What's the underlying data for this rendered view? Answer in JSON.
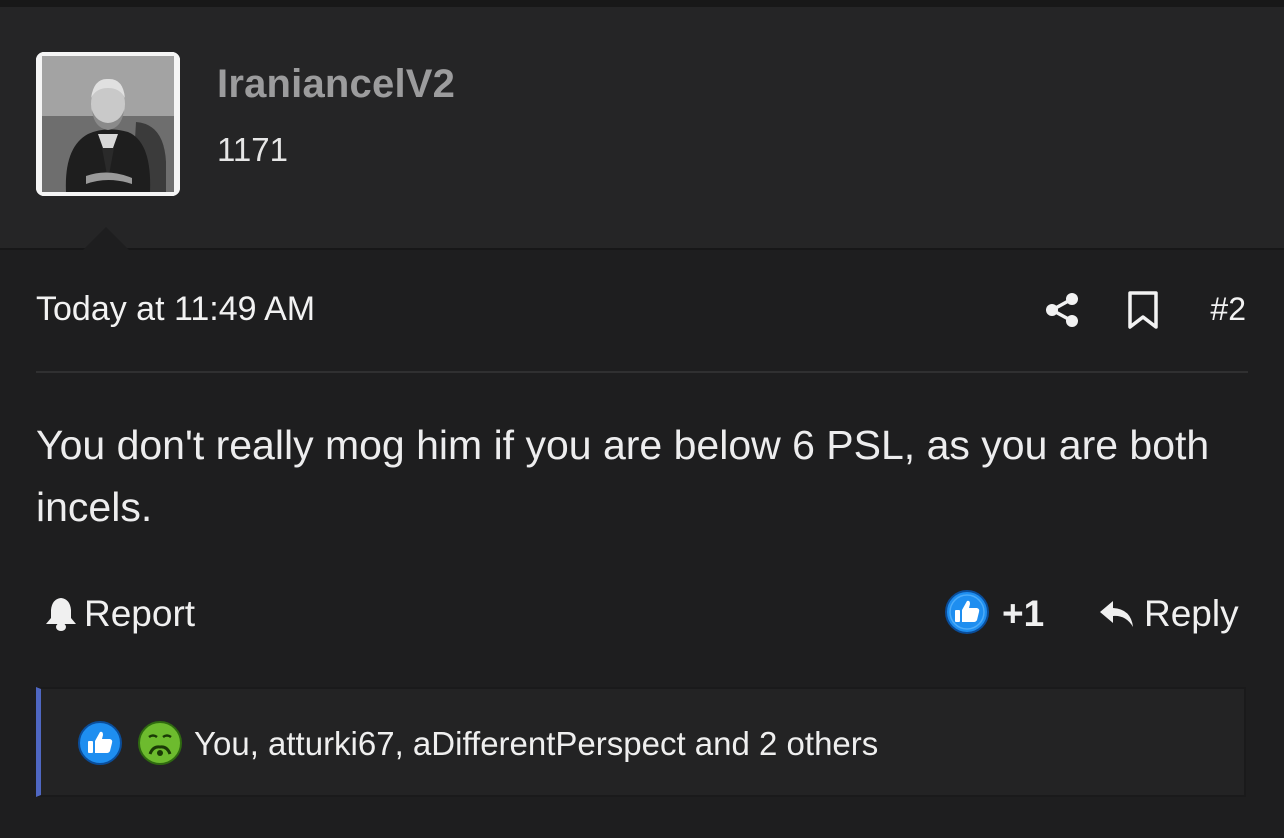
{
  "post": {
    "username": "IraniancelV2",
    "post_count": "1171",
    "timestamp": "Today at 11:49 AM",
    "post_number": "#2",
    "body": "You don't really mog him if you are below 6 PSL, as you are both incels."
  },
  "actions": {
    "report_label": "Report",
    "reaction_count": "+1",
    "reply_label": "Reply"
  },
  "reactions": {
    "summary": "You, atturki67, aDifferentPerspect and 2 others",
    "icons": [
      "like-icon",
      "sick-face-icon"
    ]
  },
  "colors": {
    "accent": "#4f67c2",
    "like_blue": "#1e8ef0",
    "sick_green": "#6dbb2e",
    "background": "#1e1e1f"
  }
}
